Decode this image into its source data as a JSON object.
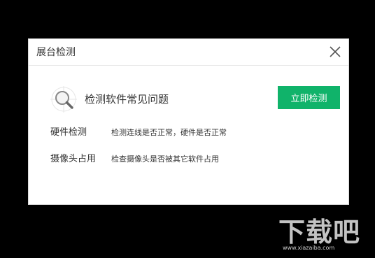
{
  "dialog": {
    "title": "展台检测",
    "close_label": "×"
  },
  "check": {
    "title": "检测软件常见问题",
    "button_label": "立即检测"
  },
  "rows": [
    {
      "label": "硬件检测",
      "description": "检测连线是否正常，硬件是否正常"
    },
    {
      "label": "摄像头占用",
      "description": "检查摄像头是否被其它软件占用"
    }
  ],
  "watermark": {
    "text": "下载吧",
    "url": "www.xiazaiba.com"
  },
  "colors": {
    "accent": "#10b36a",
    "background": "#000000",
    "dialog": "#ffffff",
    "text": "#333333"
  },
  "icons": {
    "check": "magnifier-crosshair-icon",
    "close": "close-icon"
  }
}
